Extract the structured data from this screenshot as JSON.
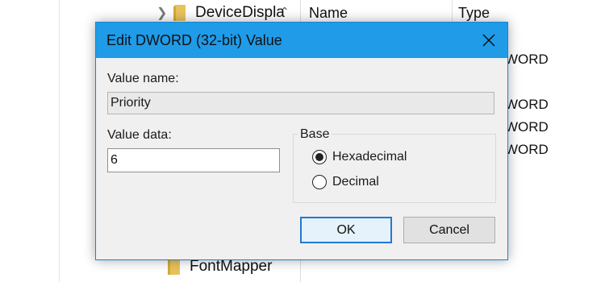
{
  "background": {
    "tree_items": [
      {
        "label": "DeviceDispla"
      },
      {
        "label": "FontMapper"
      }
    ],
    "columns": {
      "name": "Name",
      "type": "Type"
    },
    "type_cells": [
      "WORD",
      "WORD",
      "WORD",
      "WORD"
    ]
  },
  "dialog": {
    "title": "Edit DWORD (32-bit) Value",
    "value_name_label": "Value name:",
    "value_name": "Priority",
    "value_data_label": "Value data:",
    "value_data": "6",
    "base_label": "Base",
    "options": [
      {
        "label": "Hexadecimal",
        "selected": true
      },
      {
        "label": "Decimal",
        "selected": false
      }
    ],
    "ok_label": "OK",
    "cancel_label": "Cancel"
  },
  "colors": {
    "titlebar": "#1f9be8",
    "dialog_bg": "#f0f0f0",
    "default_button_border": "#1f7ad1"
  }
}
